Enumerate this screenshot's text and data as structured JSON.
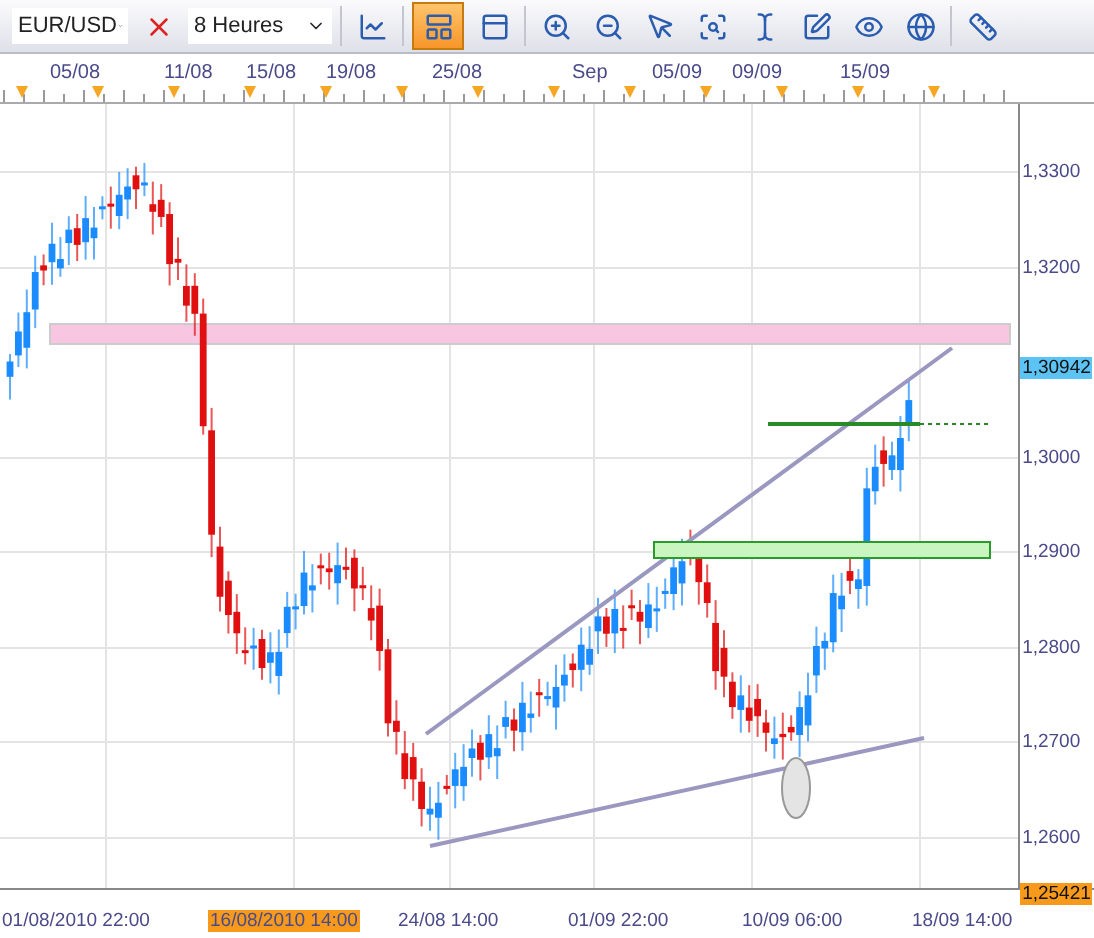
{
  "toolbar": {
    "symbol": "EUR/USD",
    "timeframe": "8 Heures",
    "buttons": [
      {
        "kind": "remove",
        "selected": false
      },
      {
        "kind": "indicators",
        "selected": false
      },
      {
        "kind": "panel",
        "selected": true
      },
      {
        "kind": "panel-text",
        "selected": false
      },
      {
        "kind": "zoom-in",
        "selected": false
      },
      {
        "kind": "zoom-out",
        "selected": false
      },
      {
        "kind": "pointer",
        "selected": false
      },
      {
        "kind": "zoom-area",
        "selected": false
      },
      {
        "kind": "text",
        "selected": false
      },
      {
        "kind": "draw",
        "selected": false
      },
      {
        "kind": "eye",
        "selected": false
      },
      {
        "kind": "globe",
        "selected": false
      },
      {
        "kind": "ruler",
        "selected": false
      }
    ]
  },
  "top_dates": [
    "05/08",
    "11/08",
    "15/08",
    "19/08",
    "25/08",
    "Sep",
    "05/09",
    "09/09",
    "15/09"
  ],
  "price_labels": [
    {
      "text": "1,3300",
      "kind": "tick"
    },
    {
      "text": "1,3200",
      "kind": "tick"
    },
    {
      "text": "1,30942",
      "kind": "current"
    },
    {
      "text": "1,3000",
      "kind": "tick"
    },
    {
      "text": "1,2900",
      "kind": "tick"
    },
    {
      "text": "1,2800",
      "kind": "tick"
    },
    {
      "text": "1,2700",
      "kind": "tick"
    },
    {
      "text": "1,2600",
      "kind": "tick"
    },
    {
      "text": "1,25421",
      "kind": "low"
    }
  ],
  "bottom_dates": [
    {
      "text": "01/08/2010 22:00",
      "selected": false
    },
    {
      "text": "16/08/2010 14:00",
      "selected": true
    },
    {
      "text": "24/08 14:00",
      "selected": false
    },
    {
      "text": "01/09 22:00",
      "selected": false
    },
    {
      "text": "10/09 06:00",
      "selected": false
    },
    {
      "text": "18/09 14:00",
      "selected": false
    }
  ]
}
